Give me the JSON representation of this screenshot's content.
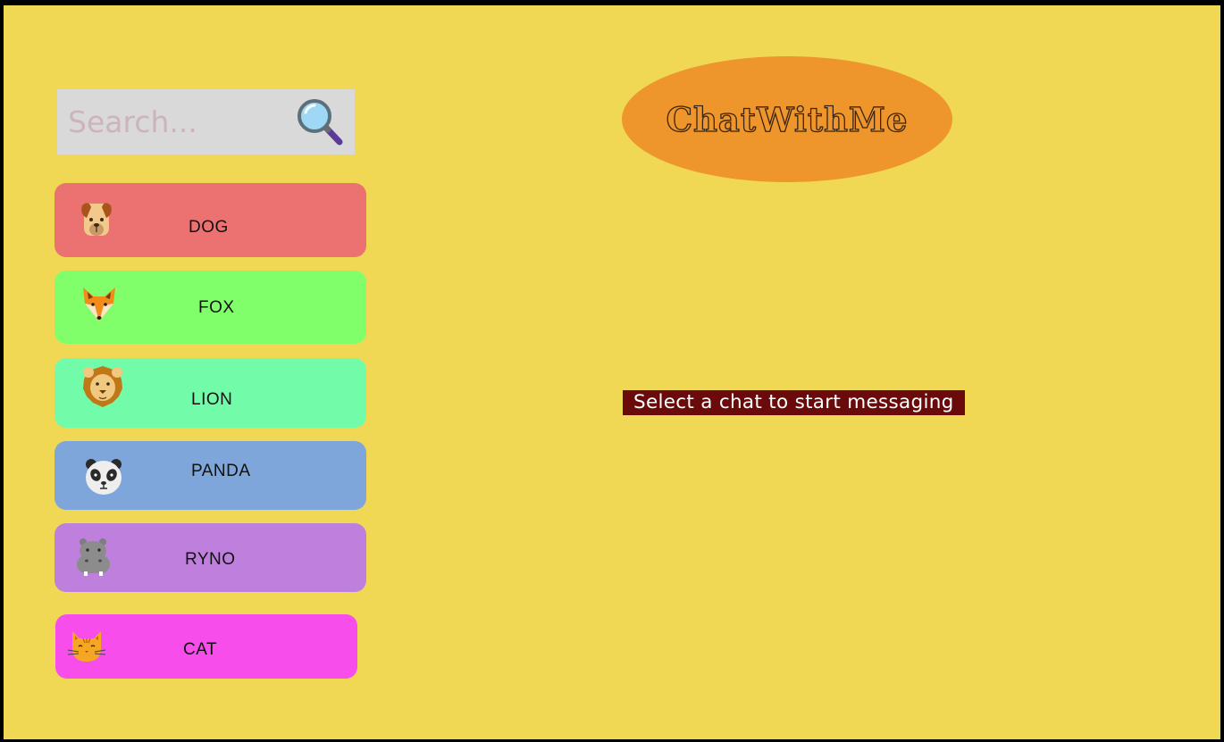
{
  "search": {
    "placeholder": "Search...",
    "icon": "magnifier-icon"
  },
  "logo": {
    "text": "ChatWithMe"
  },
  "contacts": [
    {
      "name": "DOG",
      "icon": "dog-icon",
      "color": "#ec7171"
    },
    {
      "name": "FOX",
      "icon": "fox-icon",
      "color": "#80ff6a"
    },
    {
      "name": "LION",
      "icon": "lion-icon",
      "color": "#72fcaa"
    },
    {
      "name": "PANDA",
      "icon": "panda-icon",
      "color": "#7fa6da"
    },
    {
      "name": "RYNO",
      "icon": "hippo-icon",
      "color": "#be80dc"
    },
    {
      "name": "CAT",
      "icon": "cat-icon",
      "color": "#f64deb"
    }
  ],
  "main": {
    "empty_message": "Select a chat to start messaging"
  },
  "colors": {
    "background": "#f0d855",
    "logo": "#ee962c",
    "message_bg": "#6b0a0a"
  }
}
